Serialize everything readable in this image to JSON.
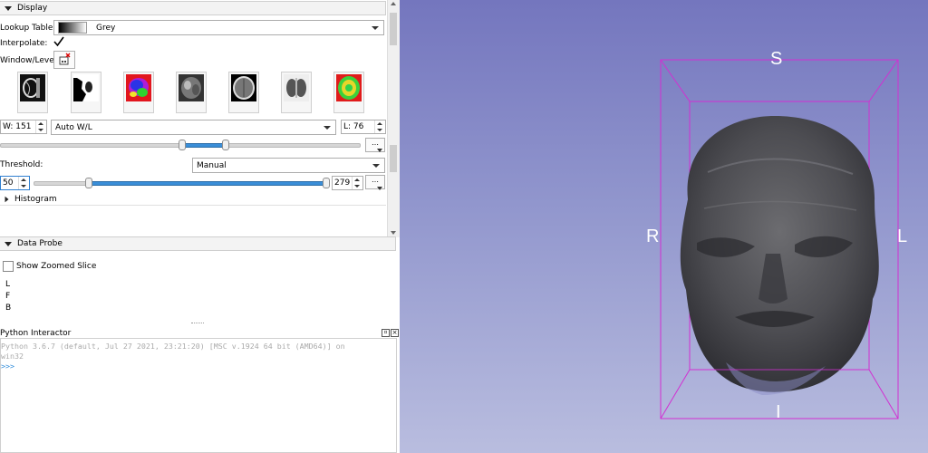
{
  "display": {
    "header": "Display",
    "lookup_label": "Lookup Table:",
    "lookup_value": "Grey",
    "interpolate_label": "Interpolate:",
    "interpolate_checked": true,
    "window_level_label": "Window/Level:",
    "w_value": "W: 151",
    "wl_mode": "Auto W/L",
    "l_value": "L: 76",
    "threshold_label": "Threshold:",
    "threshold_mode": "Manual",
    "threshold_min": "50",
    "threshold_max": "279",
    "histogram_label": "Histogram",
    "presets": [
      "CT-Bone",
      "CT-Air",
      "PET",
      "CT-Abdomen",
      "CT-Brain",
      "CT-Lung",
      "DTI"
    ]
  },
  "data_probe": {
    "header": "Data Probe",
    "show_zoomed_label": "Show Zoomed Slice",
    "lines": [
      "L",
      "F",
      "B"
    ]
  },
  "python": {
    "title": "Python Interactor",
    "line1": "Python 3.6.7 (default, Jul 27 2021, 23:21:20) [MSC v.1924 64 bit (AMD64)] on",
    "line2": "win32",
    "prompt": ">>>"
  },
  "view3d": {
    "orient_top": "S",
    "orient_left": "R",
    "orient_right": "L",
    "orient_bottom": "I",
    "box_color": "#d22fd2"
  }
}
